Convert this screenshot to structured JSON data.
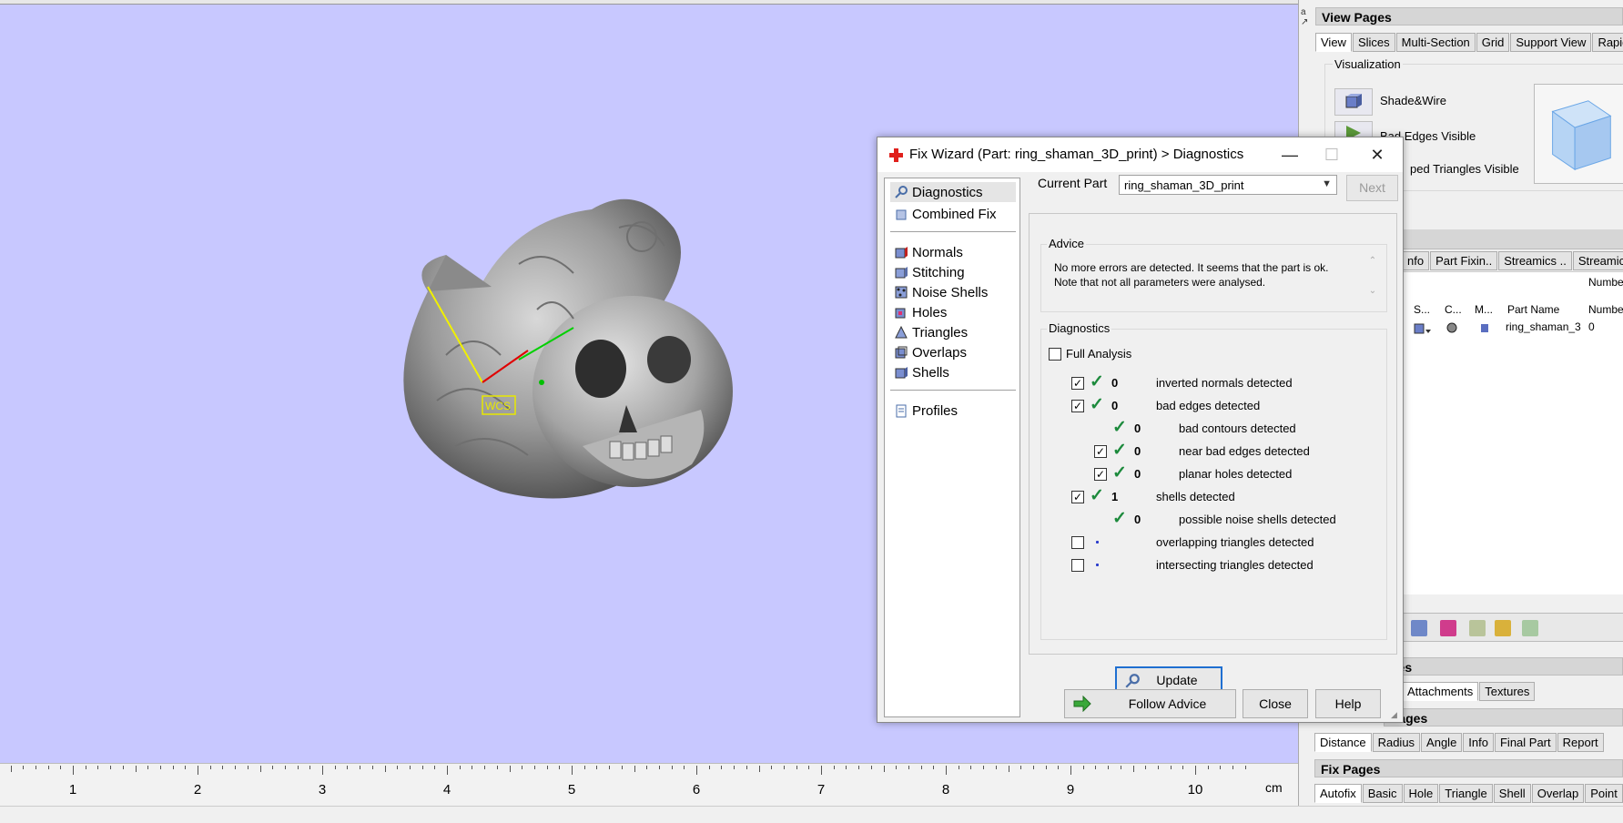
{
  "viewport": {
    "wcs_label": "WCS",
    "ruler": {
      "labels": [
        "1",
        "2",
        "3",
        "4",
        "5",
        "6",
        "7",
        "8",
        "9",
        "10"
      ],
      "unit": "cm"
    }
  },
  "right_panel": {
    "pins": "a  ↗",
    "view_pages": {
      "title": "View Pages",
      "tabs": [
        "View",
        "Slices",
        "Multi-Section",
        "Grid",
        "Support View",
        "Rapidf"
      ],
      "visualization_label": "Visualization",
      "items": [
        "Shade&Wire",
        "Bad Edges Visible",
        "ped Triangles Visible"
      ]
    },
    "part_tabs": [
      "nfo",
      "Part Fixin..",
      "Streamics ..",
      "Streamics"
    ],
    "number_label": "Numbe",
    "columns": [
      "S...",
      "C...",
      "M...",
      "Part Name",
      "Numbe"
    ],
    "row": {
      "part_name": "ring_shaman_3",
      "number": "0"
    },
    "pages_partial": "ges",
    "tabs_attach": [
      "Attachments",
      "Textures"
    ],
    "measure_pages": {
      "title": "Pages",
      "tabs": [
        "Distance",
        "Radius",
        "Angle",
        "Info",
        "Final Part",
        "Report"
      ]
    },
    "fix_pages": {
      "title": "Fix Pages",
      "tabs": [
        "Autofix",
        "Basic",
        "Hole",
        "Triangle",
        "Shell",
        "Overlap",
        "Point"
      ]
    }
  },
  "dialog": {
    "title": "Fix Wizard (Part: ring_shaman_3D_print) > Diagnostics",
    "nav": {
      "top": [
        "Diagnostics",
        "Combined Fix"
      ],
      "middle": [
        "Normals",
        "Stitching",
        "Noise Shells",
        "Holes",
        "Triangles",
        "Overlaps",
        "Shells"
      ],
      "bottom": [
        "Profiles"
      ]
    },
    "current_part_label": "Current Part",
    "current_part_value": "ring_shaman_3D_print",
    "next_label": "Next",
    "advice_label": "Advice",
    "advice_text": "No more errors are detected. It seems that the part is ok. Note that not all parameters were analysed.",
    "diagnostics_label": "Diagnostics",
    "full_analysis_label": "Full Analysis",
    "rows": [
      {
        "count": "0",
        "label": "inverted normals detected"
      },
      {
        "count": "0",
        "label": "bad edges detected"
      },
      {
        "count": "0",
        "label": "bad contours detected"
      },
      {
        "count": "0",
        "label": "near bad edges detected"
      },
      {
        "count": "0",
        "label": "planar holes detected"
      },
      {
        "count": "1",
        "label": "shells detected"
      },
      {
        "count": "0",
        "label": "possible noise shells detected"
      },
      {
        "count": "",
        "label": "overlapping triangles detected"
      },
      {
        "count": "",
        "label": "intersecting triangles detected"
      }
    ],
    "update_label": "Update",
    "follow_advice_label": "Follow Advice",
    "close_label": "Close",
    "help_label": "Help"
  },
  "colors": {
    "viewport_bg": "#c8c8ff",
    "check_green": "#1c8a3c",
    "focus_blue": "#1f6fd1",
    "title_icon_red": "#e0201c"
  }
}
